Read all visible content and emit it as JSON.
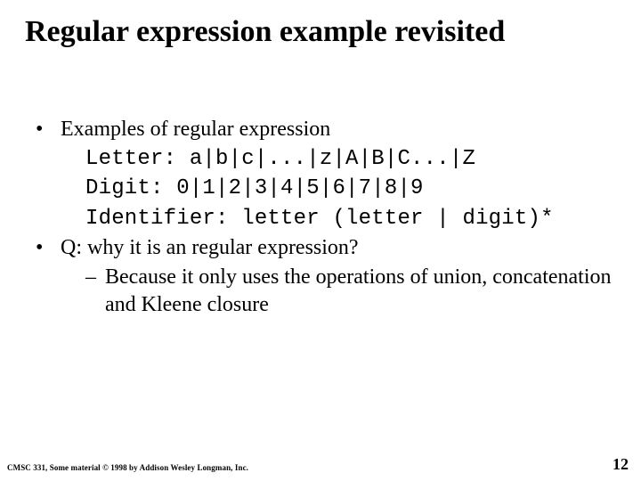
{
  "title": "Regular expression example  revisited",
  "bullets": [
    {
      "text": "Examples of regular expression",
      "children": [
        {
          "kind": "mono",
          "text": "Letter:  a|b|c|...|z|A|B|C...|Z"
        },
        {
          "kind": "mono",
          "text": "Digit: 0|1|2|3|4|5|6|7|8|9"
        },
        {
          "kind": "mono",
          "text": "Identifier: letter (letter | digit)*"
        }
      ]
    },
    {
      "text": "Q: why it is an regular expression?",
      "children": [
        {
          "kind": "dash",
          "text": "Because it only uses the operations of union, concatenation and Kleene closure"
        }
      ]
    }
  ],
  "footer": "CMSC 331, Some material © 1998 by Addison Wesley Longman, Inc.",
  "page_number": "12"
}
